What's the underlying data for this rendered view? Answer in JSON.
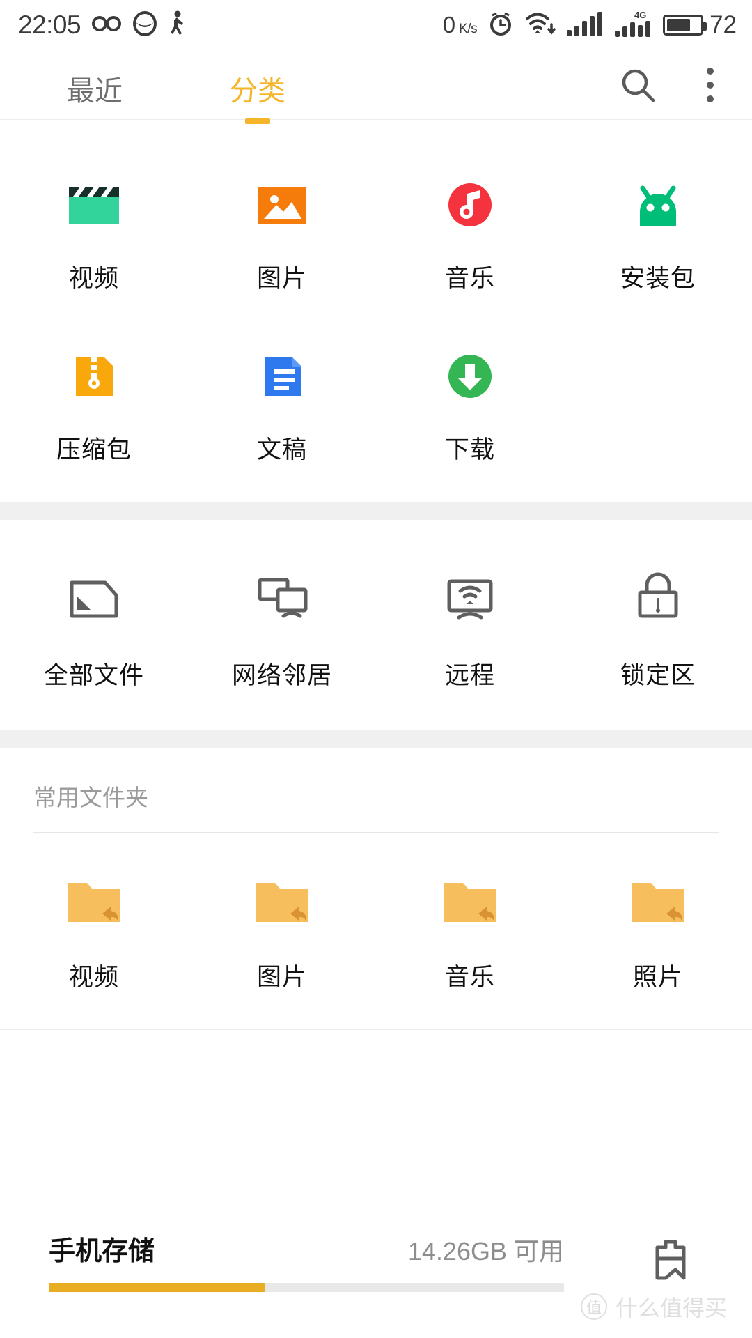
{
  "statusbar": {
    "time": "22:05",
    "icons_left": [
      "infinity-icon",
      "eye-mask-icon",
      "walking-person-icon"
    ],
    "netspeed_value": "0",
    "netspeed_unit_top": "K",
    "netspeed_unit_bottom": "s",
    "icons_right": [
      "alarm-clock-icon",
      "wifi-download-icon",
      "signal-bars-icon",
      "signal-4g-icon"
    ],
    "network_label": "4G",
    "battery_percent": "72",
    "battery_level": 72
  },
  "tabs": [
    {
      "label": "最近",
      "active": false
    },
    {
      "label": "分类",
      "active": true
    }
  ],
  "tab_actions": [
    {
      "name": "search-icon"
    },
    {
      "name": "more-options-icon"
    }
  ],
  "categories": [
    {
      "label": "视频",
      "icon": "video-clapperboard-icon",
      "color": "#33D49B"
    },
    {
      "label": "图片",
      "icon": "image-picture-icon",
      "color": "#F57B0A"
    },
    {
      "label": "音乐",
      "icon": "music-note-icon",
      "color": "#F5333F"
    },
    {
      "label": "安装包",
      "icon": "android-package-icon",
      "color": "#00BE78"
    },
    {
      "label": "压缩包",
      "icon": "zip-archive-icon",
      "color": "#F9A80B"
    },
    {
      "label": "文稿",
      "icon": "document-text-icon",
      "color": "#2F79EF"
    },
    {
      "label": "下载",
      "icon": "download-arrow-icon",
      "color": "#34B654"
    }
  ],
  "tools": [
    {
      "label": "全部文件",
      "icon": "all-files-icon"
    },
    {
      "label": "网络邻居",
      "icon": "network-neighborhood-icon"
    },
    {
      "label": "远程",
      "icon": "remote-screen-icon"
    },
    {
      "label": "锁定区",
      "icon": "lock-padlock-icon"
    }
  ],
  "frequent_folders": {
    "title": "常用文件夹",
    "items": [
      {
        "label": "视频",
        "icon": "folder-shortcut-icon"
      },
      {
        "label": "图片",
        "icon": "folder-shortcut-icon"
      },
      {
        "label": "音乐",
        "icon": "folder-shortcut-icon"
      },
      {
        "label": "照片",
        "icon": "folder-shortcut-icon"
      }
    ]
  },
  "storage": {
    "name": "手机存储",
    "free_text": "14.26GB 可用",
    "used_percent": 42,
    "action_icon": "storage-cleanup-icon"
  },
  "watermark": {
    "mark": "值",
    "text": "什么值得买"
  },
  "colors": {
    "accent": "#f5b52a",
    "folder": "#F7BE5E",
    "storage_bar": "#e8ad22",
    "band": "#f0f0f0"
  }
}
